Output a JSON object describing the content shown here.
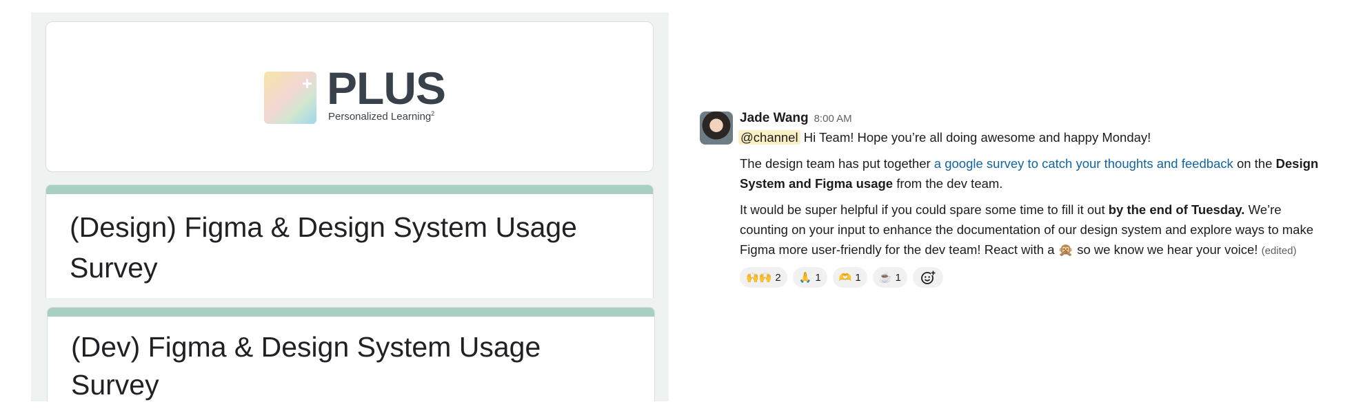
{
  "forms": {
    "logo": {
      "wordmark": "PLUS",
      "tagline": "Personalized Learning",
      "tagline_sup": "2",
      "cross": "+"
    },
    "cards": [
      {
        "title": "(Design) Figma & Design System Usage Survey",
        "accent": "#a9cfc3"
      },
      {
        "title": "(Dev) Figma & Design System Usage Survey",
        "accent": "#a9cfc3"
      }
    ]
  },
  "slack": {
    "sender": "Jade Wang",
    "time": "8:00 AM",
    "mention": "@channel",
    "line1": "Hi Team! Hope you’re all doing awesome and happy Monday!",
    "p2_before": "The design team has put together ",
    "p2_link": "a google survey to catch your thoughts and feedback",
    "p2_mid": " on the ",
    "p2_bold": "Design System and Figma usage",
    "p2_after": " from the dev team.",
    "p3_before": "It would be super helpful if you could spare some time to fill it out ",
    "p3_bold": "by the end of Tuesday.",
    "p3_after": " We’re counting on your input to enhance the documentation of our design system and explore ways to make Figma more user-friendly for the dev team! React with a ",
    "p3_emoji": "🙊",
    "p3_end": " so we know we hear your voice!",
    "edited": "(edited)",
    "reactions": [
      {
        "emoji": "🙌🙌",
        "count": "2",
        "icon": "raised-hands-icon"
      },
      {
        "emoji": "🙏",
        "count": "1",
        "icon": "folded-hands-icon"
      },
      {
        "emoji": "🫶",
        "count": "1",
        "icon": "heart-hands-icon"
      },
      {
        "emoji": "☕",
        "count": "1",
        "icon": "coffee-icon"
      }
    ],
    "link_color": "#1264a3",
    "mention_bg": "#fbefc4"
  }
}
